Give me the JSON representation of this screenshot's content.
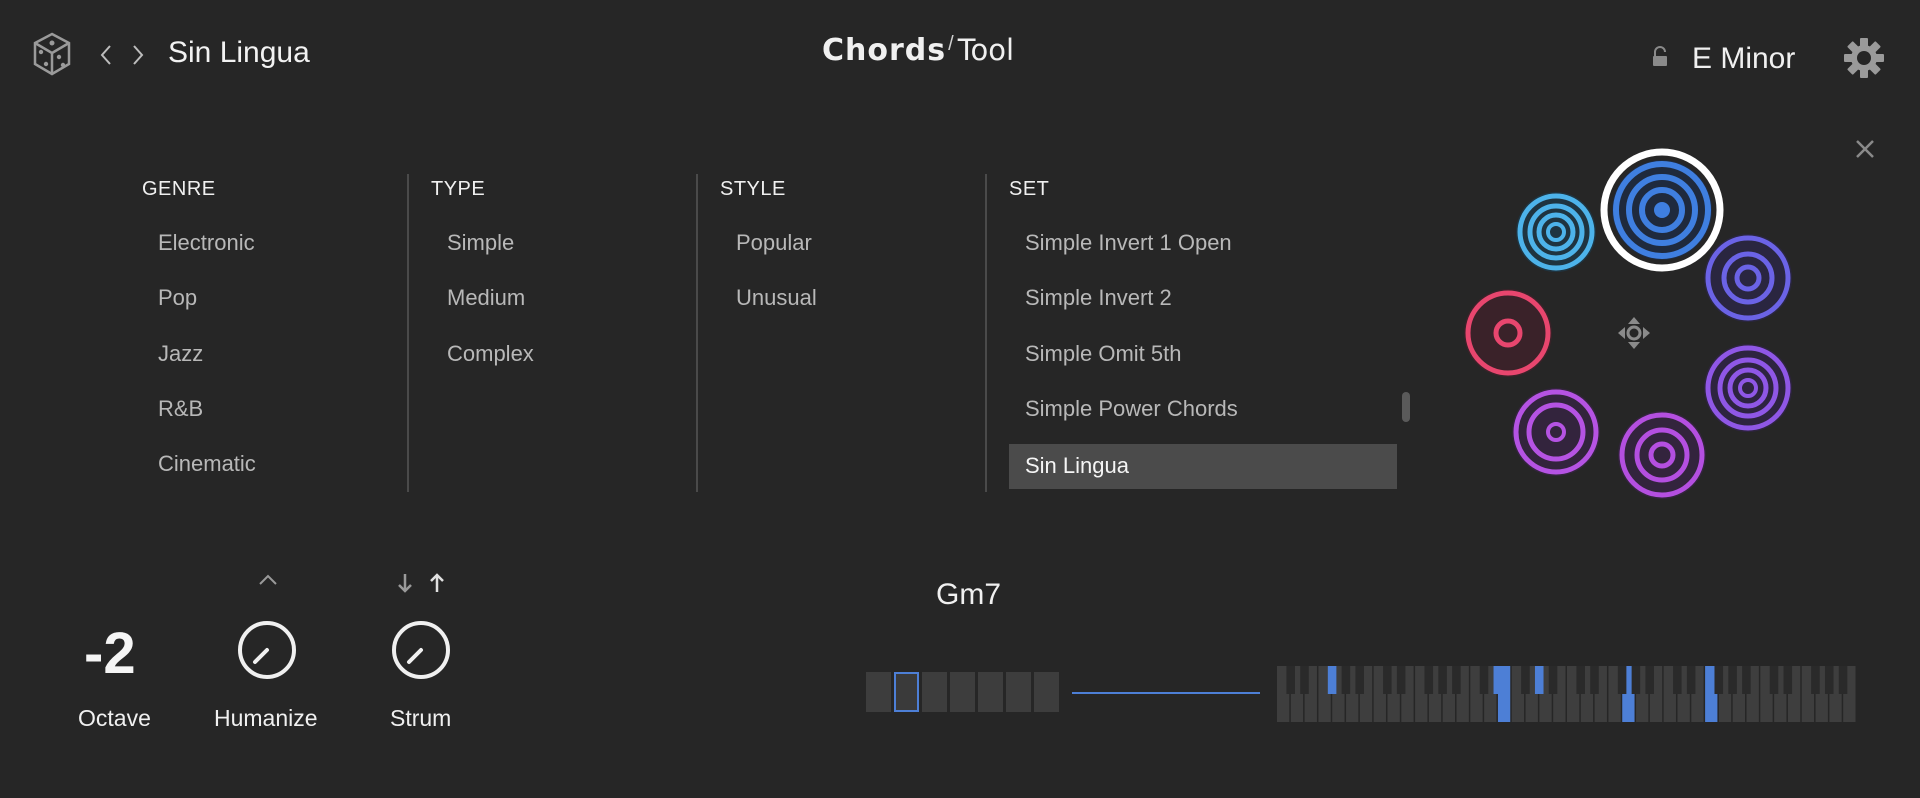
{
  "header": {
    "preset_name": "Sin Lingua",
    "logo_main": "Chords",
    "logo_slash": "/",
    "logo_sub": "Tool",
    "key": "E Minor",
    "icons": [
      "dice-icon",
      "chevron-left-icon",
      "chevron-right-icon",
      "lock-icon",
      "gear-icon",
      "close-icon"
    ]
  },
  "browser": {
    "columns": [
      {
        "heading": "GENRE",
        "items": [
          "Electronic",
          "Pop",
          "Jazz",
          "R&B",
          "Cinematic"
        ]
      },
      {
        "heading": "TYPE",
        "items": [
          "Simple",
          "Medium",
          "Complex"
        ]
      },
      {
        "heading": "STYLE",
        "items": [
          "Popular",
          "Unusual"
        ]
      },
      {
        "heading": "SET",
        "items": [
          "Simple Invert 1 Open",
          "Simple Invert 2",
          "Simple Omit 5th",
          "Simple Power Chords",
          "Sin Lingua"
        ],
        "selected": "Sin Lingua"
      }
    ]
  },
  "pads": {
    "colors": [
      "#4db3ea",
      "#3f7fe0",
      "#6b63e6",
      "#e8466e",
      "#8f57e6",
      "#b553e3",
      "#b44fe0"
    ],
    "active_ring_color": "#ffffff"
  },
  "controls": {
    "octave_value": "-2",
    "octave_label": "Octave",
    "humanize_label": "Humanize",
    "strum_label": "Strum",
    "humanize_icon": "chevron-up-icon",
    "strum_icons": [
      "arrow-down-icon",
      "arrow-up-icon"
    ]
  },
  "chord": {
    "name": "Gm7"
  },
  "colors": {
    "background": "#262626",
    "accent_blue": "#4d7fd6"
  }
}
